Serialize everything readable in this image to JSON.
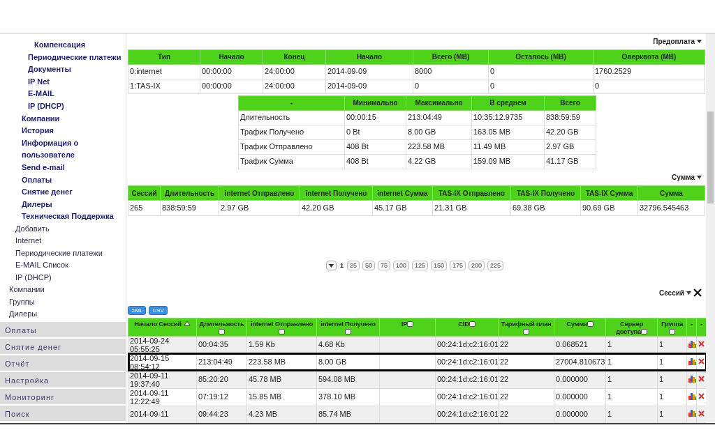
{
  "sidebar": {
    "admin_menu": [
      {
        "children": [
          {
            "children": [
              {
                "label": "Компенсация"
              }
            ]
          },
          {
            "label": "Периодические платежи"
          },
          {
            "label": "Документы"
          },
          {
            "label": "IP Net"
          },
          {
            "label": "E-MAIL"
          },
          {
            "label": "IP (DHCP)"
          }
        ]
      },
      {
        "label": "Компании"
      },
      {
        "label": "История"
      },
      {
        "label": "Информация о пользователе"
      },
      {
        "label": "Send e-mail"
      },
      {
        "label": "Оплаты"
      },
      {
        "label": "Снятие денег"
      },
      {
        "label": "Дилеры"
      },
      {
        "label": "Техническая Поддержка"
      }
    ],
    "menu": [
      {
        "children": [
          {
            "label": "Добавить"
          },
          {
            "label": "Internet"
          },
          {
            "label": "Периодические платежи"
          },
          {
            "label": "E-MAIL Список"
          },
          {
            "label": "IP (DHCP)"
          }
        ]
      },
      {
        "label": "Компании"
      },
      {
        "label": "Группы"
      },
      {
        "label": "Дилеры"
      }
    ],
    "sections": [
      "Оплаты",
      "Снятие денег",
      "Отчёт",
      "Настройка",
      "Мониторинг",
      "Поиск"
    ]
  },
  "prepay": {
    "title": "Предоплата",
    "columns": [
      "Тип",
      "Начало",
      "Конец",
      "Начало",
      "Всего (MB)",
      "Осталось (MB)",
      "Оверквота (MB)"
    ],
    "rows": [
      [
        "0:internet",
        "00:00:00",
        "24:00:00",
        "2014-09-09",
        "8000",
        "0",
        "1760.2529"
      ],
      [
        "1:TAS-IX",
        "00:00:00",
        "24:00:00",
        "2014-09-09",
        "0",
        "0",
        "0"
      ]
    ]
  },
  "stats": {
    "columns": [
      "-",
      "Минимально",
      "Максимально",
      "В среднем",
      "Всего"
    ],
    "rows": [
      [
        "Длительность",
        "00:00:15",
        "213:04:49",
        "10:35:12.9735",
        "838:59:59"
      ],
      [
        "Трафик Получено",
        "0 Bt",
        "8.00 GB",
        "163.05 MB",
        "42.20 GB"
      ],
      [
        "Трафик Отправлено",
        "408 Bt",
        "223.58 MB",
        "11.49 MB",
        "2.97 GB"
      ],
      [
        "Трафик Сумма",
        "408 Bt",
        "4.22 GB",
        "159.09 MB",
        "41.17 GB"
      ]
    ]
  },
  "totals": {
    "title": "Сумма",
    "columns": [
      "Сессий",
      "Длительность",
      "internet Отправлено",
      "internet Получено",
      "internet Сумма",
      "TAS-IX Отправлено",
      "TAS-IX Получено",
      "TAS-IX Сумма",
      "Сумма"
    ],
    "rows": [
      [
        "265",
        "838:59:59",
        "2.97 GB",
        "42.20 GB",
        "45.17 GB",
        "21.31 GB",
        "69.38 GB",
        "90.69 GB",
        "32796.545463"
      ]
    ]
  },
  "pagination": [
    {
      "label": "1",
      "selected": true
    },
    {
      "label": "25",
      "selected": false
    },
    {
      "label": "50",
      "selected": false
    },
    {
      "label": "75",
      "selected": false
    },
    {
      "label": "100",
      "selected": false
    },
    {
      "label": "125",
      "selected": false
    },
    {
      "label": "150",
      "selected": false
    },
    {
      "label": "175",
      "selected": false
    },
    {
      "label": "200",
      "selected": false
    },
    {
      "label": "225",
      "selected": false
    }
  ],
  "sessions": {
    "title": "Сессий",
    "exports": [
      "XML",
      "CSV"
    ],
    "columns": [
      {
        "label": "Начало Сессий",
        "kind": "sort"
      },
      {
        "label": "Длительность",
        "kind": "filter",
        "checked": false
      },
      {
        "label": "internet Отправлено",
        "kind": "filter",
        "checked": false
      },
      {
        "label": "internet Получено",
        "kind": "filter",
        "checked": false
      },
      {
        "label": "IP",
        "kind": "filter",
        "checked": false
      },
      {
        "label": "CID",
        "kind": "filter",
        "checked": false
      },
      {
        "label": "Тарифный план",
        "kind": "filter",
        "checked": false
      },
      {
        "label": "Сумма",
        "kind": "filter",
        "checked": false
      },
      {
        "label": "Сервер доступа",
        "kind": "filter",
        "checked": false
      },
      {
        "label": "Группа",
        "kind": "filter",
        "checked": false
      },
      {
        "label": "-",
        "kind": "plain"
      },
      {
        "label": "-",
        "kind": "plain"
      }
    ],
    "rows": [
      {
        "cells": [
          "2014-09-24 05:55:25",
          "00:04:35",
          "1.59 Kb",
          "4.68 Kb",
          "",
          "00:24:1d:c2:16:01",
          "22",
          "0.068521",
          "1",
          "1"
        ],
        "selected": false
      },
      {
        "cells": [
          "2014-09-15 08:54:12",
          "213:04:49",
          "223.58 MB",
          "8.00 GB",
          "",
          "00:24:1d:c2:16:01",
          "22",
          "27004.810673",
          "1",
          "1"
        ],
        "selected": true
      },
      {
        "cells": [
          "2014-09-11 19:37:40",
          "85:20:20",
          "45.78 MB",
          "594.08 MB",
          "",
          "00:24:1d:c2:16:01",
          "22",
          "0.000000",
          "1",
          "1"
        ],
        "selected": false
      },
      {
        "cells": [
          "2014-09-11 12:22:49",
          "07:19:12",
          "15.85 MB",
          "378.10 MB",
          "",
          "00:24:1d:c2:16:01",
          "22",
          "0.000000",
          "1",
          "1"
        ],
        "selected": false
      },
      {
        "cells": [
          "2014-09-11",
          "09:44:23",
          "4.23 MB",
          "85.74 MB",
          "",
          "00:24:1d:c2:16:01",
          "22",
          "0.000000",
          "1",
          "1"
        ],
        "selected": false
      }
    ]
  }
}
